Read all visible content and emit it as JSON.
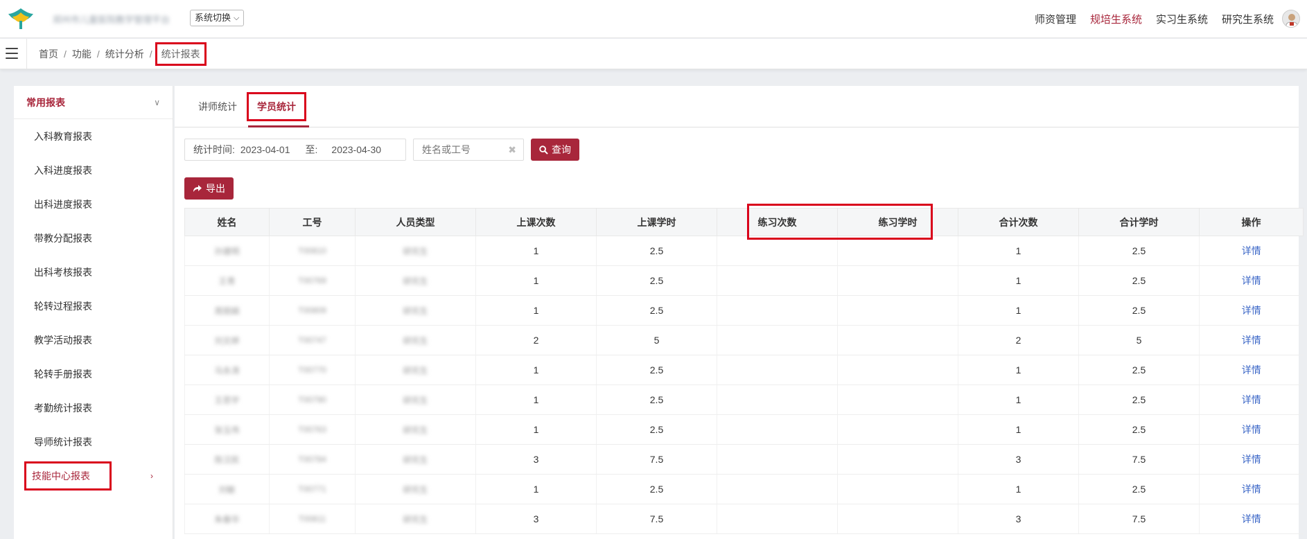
{
  "header": {
    "site_name": "郑州市儿童医院教学管理平台",
    "system_switch": "系统切换",
    "nav": [
      "师资管理",
      "规培生系统",
      "实习生系统",
      "研究生系统"
    ],
    "nav_active_index": 1
  },
  "breadcrumb": {
    "items": [
      "首页",
      "功能",
      "统计分析"
    ],
    "current": "统计报表"
  },
  "sidebar": {
    "group_title": "常用报表",
    "items": [
      "入科教育报表",
      "入科进度报表",
      "出科进度报表",
      "带教分配报表",
      "出科考核报表",
      "轮转过程报表",
      "教学活动报表",
      "轮转手册报表",
      "考勤统计报表",
      "导师统计报表"
    ],
    "active_item": "技能中心报表"
  },
  "tabs": {
    "teacher": "讲师统计",
    "student": "学员统计"
  },
  "filters": {
    "date_label": "统计时间:",
    "date_start": "2023-04-01",
    "date_to": "至:",
    "date_end": "2023-04-30",
    "search_placeholder": "姓名或工号",
    "query_label": "查询",
    "export_label": "导出"
  },
  "table": {
    "columns": [
      "姓名",
      "工号",
      "人员类型",
      "上课次数",
      "上课学时",
      "练习次数",
      "练习学时",
      "合计次数",
      "合计学时",
      "操作"
    ],
    "action_label": "详情",
    "rows": [
      {
        "name": "孙建明",
        "id": "T00810",
        "type": "研究生",
        "classes": "1",
        "class_hours": "2.5",
        "practice": "",
        "practice_hours": "",
        "total": "1",
        "total_hours": "2.5"
      },
      {
        "name": "王青",
        "id": "T00769",
        "type": "研究生",
        "classes": "1",
        "class_hours": "2.5",
        "practice": "",
        "practice_hours": "",
        "total": "1",
        "total_hours": "2.5"
      },
      {
        "name": "周丽娟",
        "id": "T00809",
        "type": "研究生",
        "classes": "1",
        "class_hours": "2.5",
        "practice": "",
        "practice_hours": "",
        "total": "1",
        "total_hours": "2.5"
      },
      {
        "name": "刘文婷",
        "id": "T00747",
        "type": "研究生",
        "classes": "2",
        "class_hours": "5",
        "practice": "",
        "practice_hours": "",
        "total": "2",
        "total_hours": "5"
      },
      {
        "name": "马永涛",
        "id": "T00770",
        "type": "研究生",
        "classes": "1",
        "class_hours": "2.5",
        "practice": "",
        "practice_hours": "",
        "total": "1",
        "total_hours": "2.5"
      },
      {
        "name": "王思宇",
        "id": "T00790",
        "type": "研究生",
        "classes": "1",
        "class_hours": "2.5",
        "practice": "",
        "practice_hours": "",
        "total": "1",
        "total_hours": "2.5"
      },
      {
        "name": "张玉伟",
        "id": "T00763",
        "type": "研究生",
        "classes": "1",
        "class_hours": "2.5",
        "practice": "",
        "practice_hours": "",
        "total": "1",
        "total_hours": "2.5"
      },
      {
        "name": "陈汉民",
        "id": "T00784",
        "type": "研究生",
        "classes": "3",
        "class_hours": "7.5",
        "practice": "",
        "practice_hours": "",
        "total": "3",
        "total_hours": "7.5"
      },
      {
        "name": "刘敏",
        "id": "T00771",
        "type": "研究生",
        "classes": "1",
        "class_hours": "2.5",
        "practice": "",
        "practice_hours": "",
        "total": "1",
        "total_hours": "2.5"
      },
      {
        "name": "朱春华",
        "id": "T00811",
        "type": "研究生",
        "classes": "3",
        "class_hours": "7.5",
        "practice": "",
        "practice_hours": "",
        "total": "3",
        "total_hours": "7.5"
      }
    ]
  },
  "colors": {
    "accent": "#a8263b",
    "highlight_box": "#d9001b",
    "link": "#3a66c7"
  }
}
